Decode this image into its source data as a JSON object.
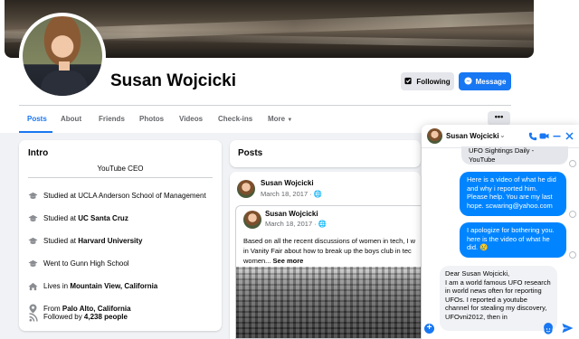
{
  "profile": {
    "name": "Susan Wojcicki",
    "following_label": "Following",
    "message_label": "Message"
  },
  "tabs": [
    {
      "label": "Posts",
      "active": true
    },
    {
      "label": "About"
    },
    {
      "label": "Friends"
    },
    {
      "label": "Photos"
    },
    {
      "label": "Videos"
    },
    {
      "label": "Check-ins"
    },
    {
      "label": "More"
    }
  ],
  "more_dots": "•••",
  "intro": {
    "title": "Intro",
    "bio": "YouTube CEO",
    "items": [
      {
        "icon": "graduation-cap-icon",
        "prefix": "Studied at ",
        "bold": "UCLA Anderson School of Management",
        "bold_weight": "normal"
      },
      {
        "icon": "graduation-cap-icon",
        "prefix": "Studied at ",
        "bold": "UC Santa Cruz"
      },
      {
        "icon": "graduation-cap-icon",
        "prefix": "Studied at ",
        "bold": "Harvard University"
      },
      {
        "icon": "graduation-cap-icon",
        "prefix": "Went to ",
        "bold": "Gunn High School",
        "bold_weight": "normal"
      },
      {
        "icon": "home-icon",
        "prefix": "Lives in ",
        "bold": "Mountain View, California"
      },
      {
        "icon": "location-pin-icon",
        "prefix": "From ",
        "bold": "Palo Alto, California"
      },
      {
        "icon": "rss-icon",
        "prefix": "Followed by ",
        "bold": "4,238 people"
      }
    ]
  },
  "posts": {
    "title": "Posts",
    "author": "Susan Wojcicki",
    "date": "March 18, 2017 · 🌐",
    "shared_author": "Susan Wojcicki",
    "shared_date": "March 18, 2017 · 🌐",
    "text_line1": "Based on all the recent discussions of women in tech, I w",
    "text_line2": "in Vanity Fair about how to break up the boys club in tec",
    "text_line3_prefix": "women... ",
    "see_more": "See more"
  },
  "chat": {
    "name": "Susan Wojcicki",
    "colors": {
      "accent": "#1877f2",
      "bubble": "#0084ff"
    },
    "incoming_top": "UFO Sightings Daily - YouTube",
    "outgoing": [
      "Here is a video of what he did and why i reported him. Please help. You are my last hope. scwaring@yahoo.com",
      "I apologize for bothering you. here is the video of what he did. 😢"
    ],
    "compose_text": "Dear Susan Wojcicki,\nI am a world famous UFO research in world news often for reporting UFOs. I reported a youtube channel for stealing my discovery, UFOvni2012, then in"
  }
}
